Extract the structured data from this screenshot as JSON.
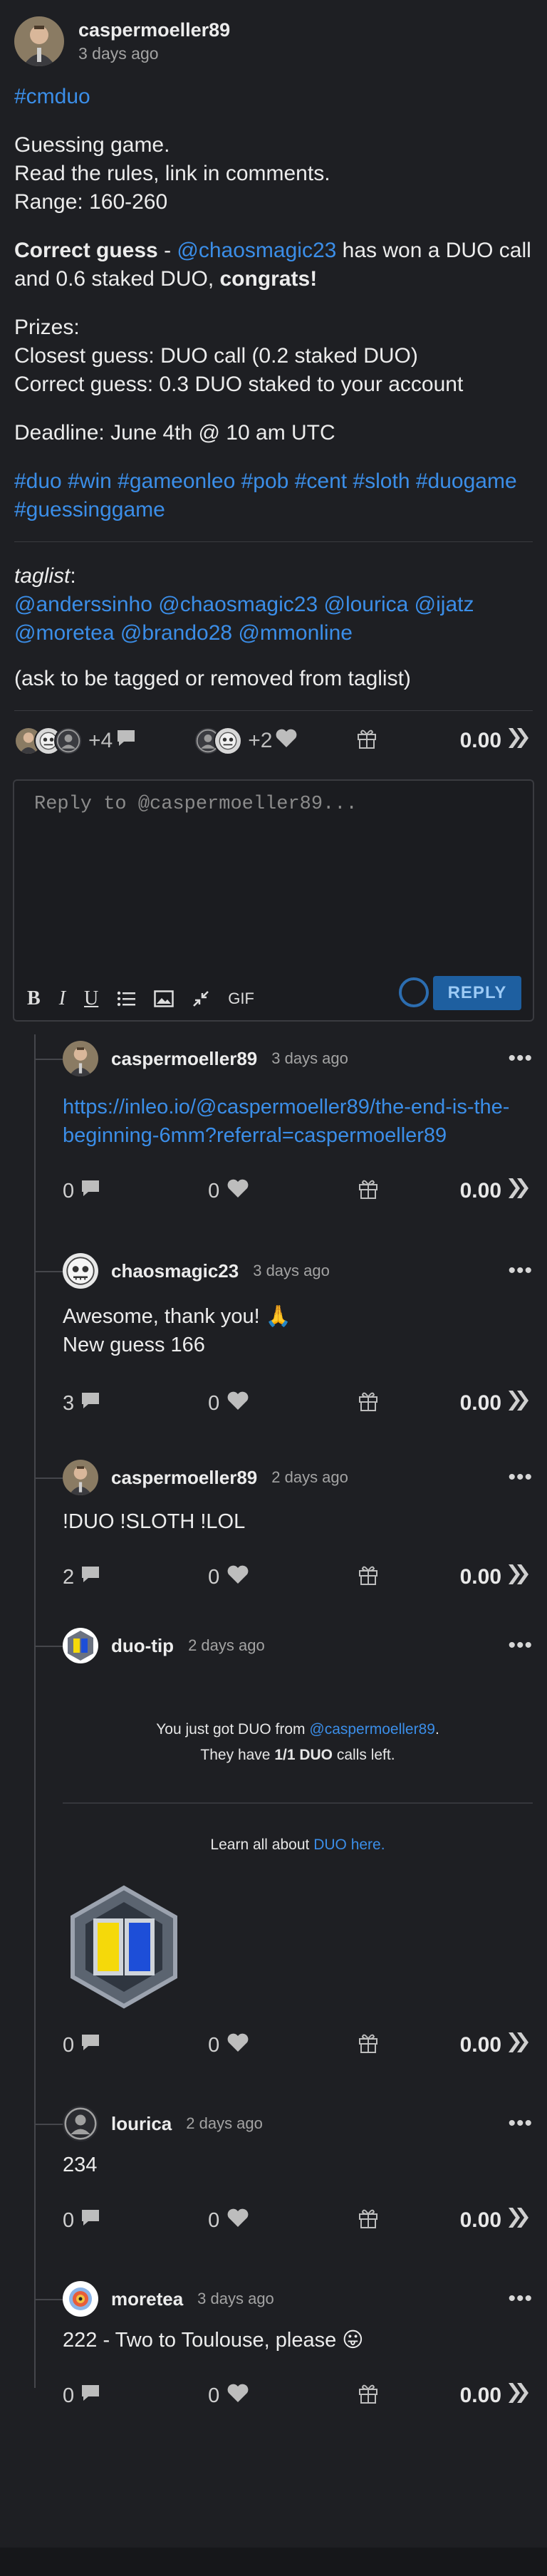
{
  "post": {
    "author": "caspermoeller89",
    "time": "3 days ago",
    "community_tag": "#cmduo",
    "lines": [
      "Guessing game.",
      "Read the rules, link in comments.",
      "Range: 160-260"
    ],
    "correct_guess_label": "Correct guess",
    "correct_guess_sep": " - ",
    "winner": "@chaosmagic23",
    "winner_text_1": " has won a DUO call",
    "winner_text_2": "and 0.6 staked DUO, ",
    "congrats": "congrats!",
    "prizes_title": "Prizes:",
    "prize_1": "Closest guess: DUO call (0.2 staked DUO)",
    "prize_2": "Correct guess: 0.3 DUO staked to your account",
    "deadline": "Deadline: June 4th @ 10 am UTC",
    "hashtags_line1": [
      "#duo",
      "#win",
      "#gameonleo",
      "#pob",
      "#cent",
      "#sloth",
      "#duogame"
    ],
    "hashtags_line2": [
      "#guessinggame"
    ],
    "taglist_label": "taglist",
    "taglist_colon": ":",
    "taglist_line1": [
      "@anderssinho",
      "@chaosmagic23",
      "@lourica",
      "@ijatz"
    ],
    "taglist_line2": [
      "@moretea",
      "@brando28",
      "@mmonline"
    ],
    "taglist_note": "(ask to be tagged or removed from taglist)"
  },
  "post_actions": {
    "comments_extra": "+4",
    "likes_extra": "+2",
    "value": "0.00"
  },
  "reply_box": {
    "placeholder": "Reply to @caspermoeller89...",
    "gif_label": "GIF",
    "reply_label": "REPLY"
  },
  "comments": [
    {
      "author": "caspermoeller89",
      "time": "3 days ago",
      "link_text_1": "https://inleo.io/@caspermoeller89/the-end-is-the-",
      "link_text_2": "beginning-6mm?referral=caspermoeller89",
      "replies": "0",
      "likes": "0",
      "value": "0.00"
    },
    {
      "author": "chaosmagic23",
      "time": "3 days ago",
      "line1": "Awesome, thank you! 🙏",
      "line2": "New guess 166",
      "replies": "3",
      "likes": "0",
      "value": "0.00"
    },
    {
      "author": "caspermoeller89",
      "time": "2 days ago",
      "line1": "!DUO !SLOTH !LOL",
      "replies": "2",
      "likes": "0",
      "value": "0.00"
    },
    {
      "author": "duo-tip",
      "time": "2 days ago",
      "got_text": "You just got DUO from ",
      "got_user": "@caspermoeller89",
      "got_end": ".",
      "calls_pre": "They have ",
      "calls_bold": "1/1 DUO",
      "calls_post": " calls left.",
      "learn_pre": "Learn all about ",
      "learn_link": "DUO here.",
      "replies": "0",
      "likes": "0",
      "value": "0.00"
    },
    {
      "author": "lourica",
      "time": "2 days ago",
      "line1": "234",
      "replies": "0",
      "likes": "0",
      "value": "0.00"
    },
    {
      "author": "moretea",
      "time": "3 days ago",
      "line1": "222 - Two to Toulouse, please 😛",
      "replies": "0",
      "likes": "0",
      "value": "0.00"
    }
  ],
  "more_label": "•••",
  "colors": {
    "link": "#3b8ee8",
    "background": "#1e1f23",
    "reply_button": "#1e5fa0"
  }
}
